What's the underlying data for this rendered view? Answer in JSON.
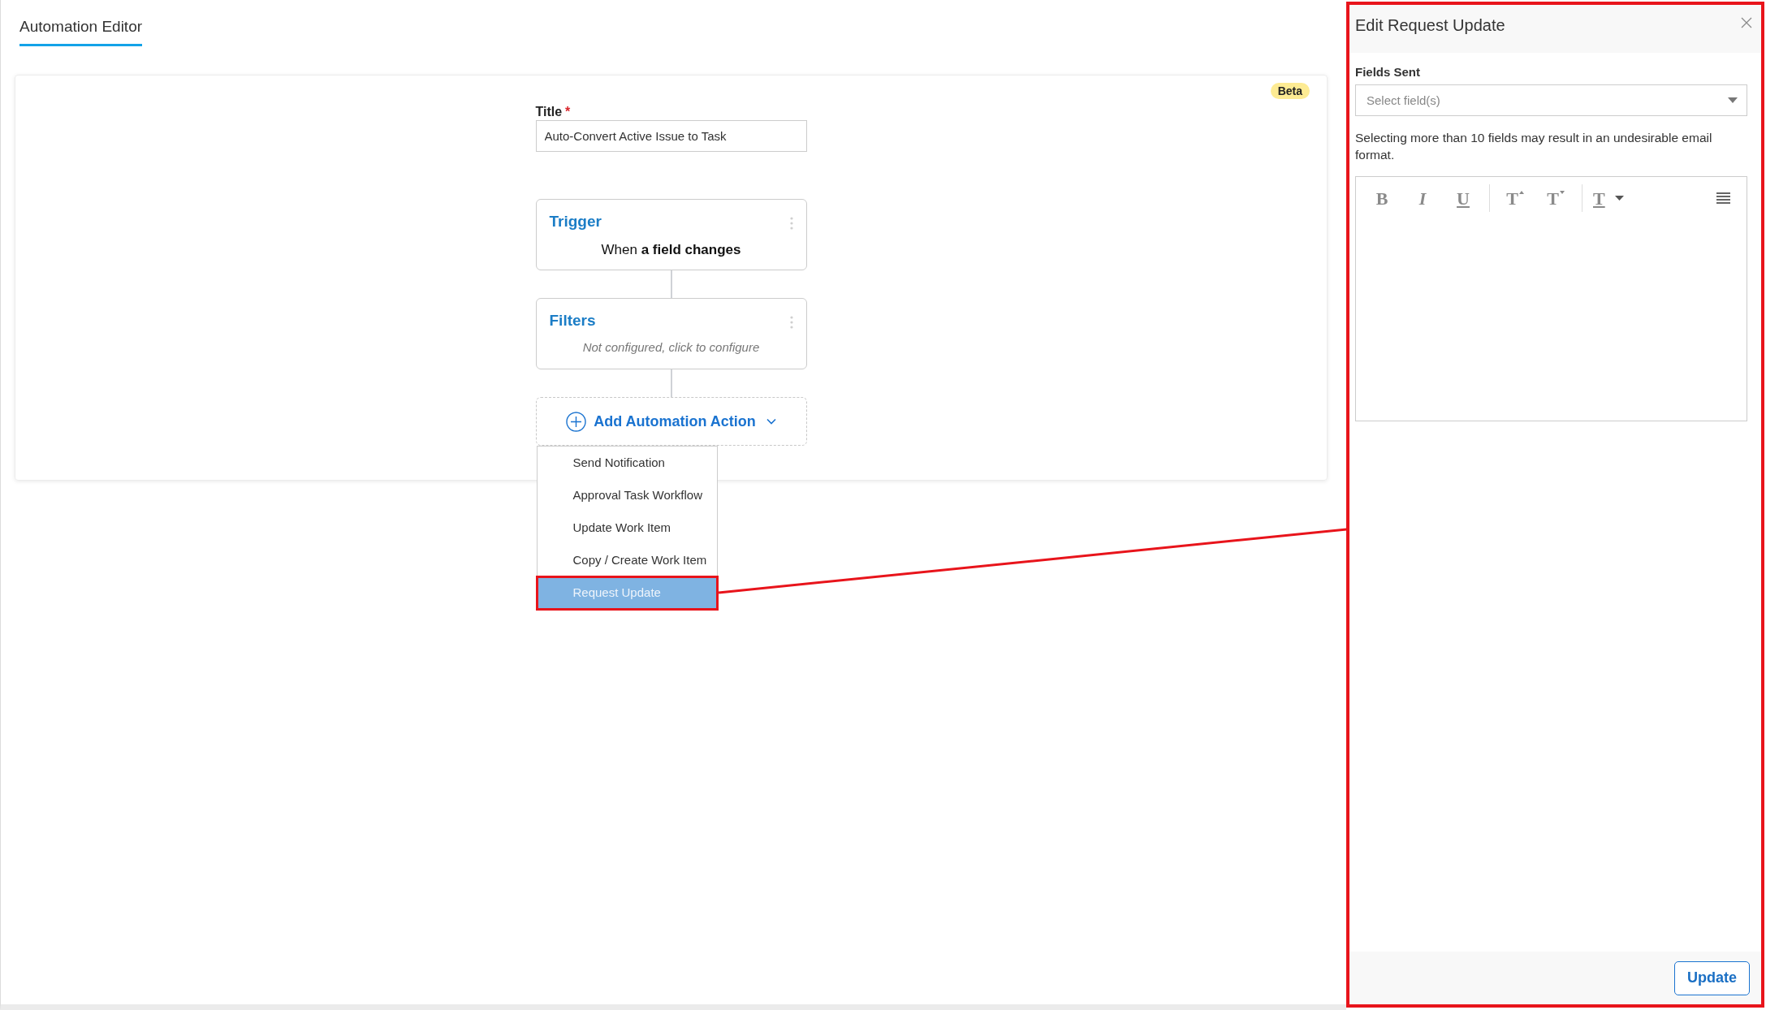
{
  "tabs": [
    {
      "label": "Automation Editor",
      "selected": true
    }
  ],
  "editor": {
    "badge": "Beta",
    "title_field": {
      "label": "Title",
      "required_mark": "*",
      "value": "Auto-Convert Active Issue to Task"
    },
    "nodes": [
      {
        "heading": "Trigger",
        "description": "When **a field changes**",
        "configured": true
      },
      {
        "heading": "Filters",
        "description": "Not configured, click to configure",
        "configured": false
      }
    ],
    "add_action": {
      "label": "Add Automation Action",
      "expanded": true,
      "menu": [
        {
          "label": "Send Notification",
          "selected": false
        },
        {
          "label": "Approval Task Workflow",
          "selected": false
        },
        {
          "label": "Update Work Item",
          "selected": false
        },
        {
          "label": "Copy / Create Work Item",
          "selected": false
        },
        {
          "label": "Request Update",
          "selected": true
        }
      ]
    }
  },
  "panel": {
    "title": "Edit Request Update",
    "fields_label": "Fields Sent",
    "fields_select": {
      "placeholder": "Select field(s)"
    },
    "hint": "Selecting more than 10 fields may result in an undesirable email format.",
    "toolbar": [
      {
        "kind": "bold",
        "label": "B"
      },
      {
        "kind": "italic",
        "label": "I"
      },
      {
        "kind": "underline",
        "label": "U"
      },
      {
        "kind": "separator"
      },
      {
        "kind": "size-up",
        "label": "T"
      },
      {
        "kind": "size-down",
        "label": "T"
      },
      {
        "kind": "separator"
      },
      {
        "kind": "text-style",
        "label": "T"
      },
      {
        "kind": "align"
      }
    ],
    "footer_button": "Update"
  }
}
